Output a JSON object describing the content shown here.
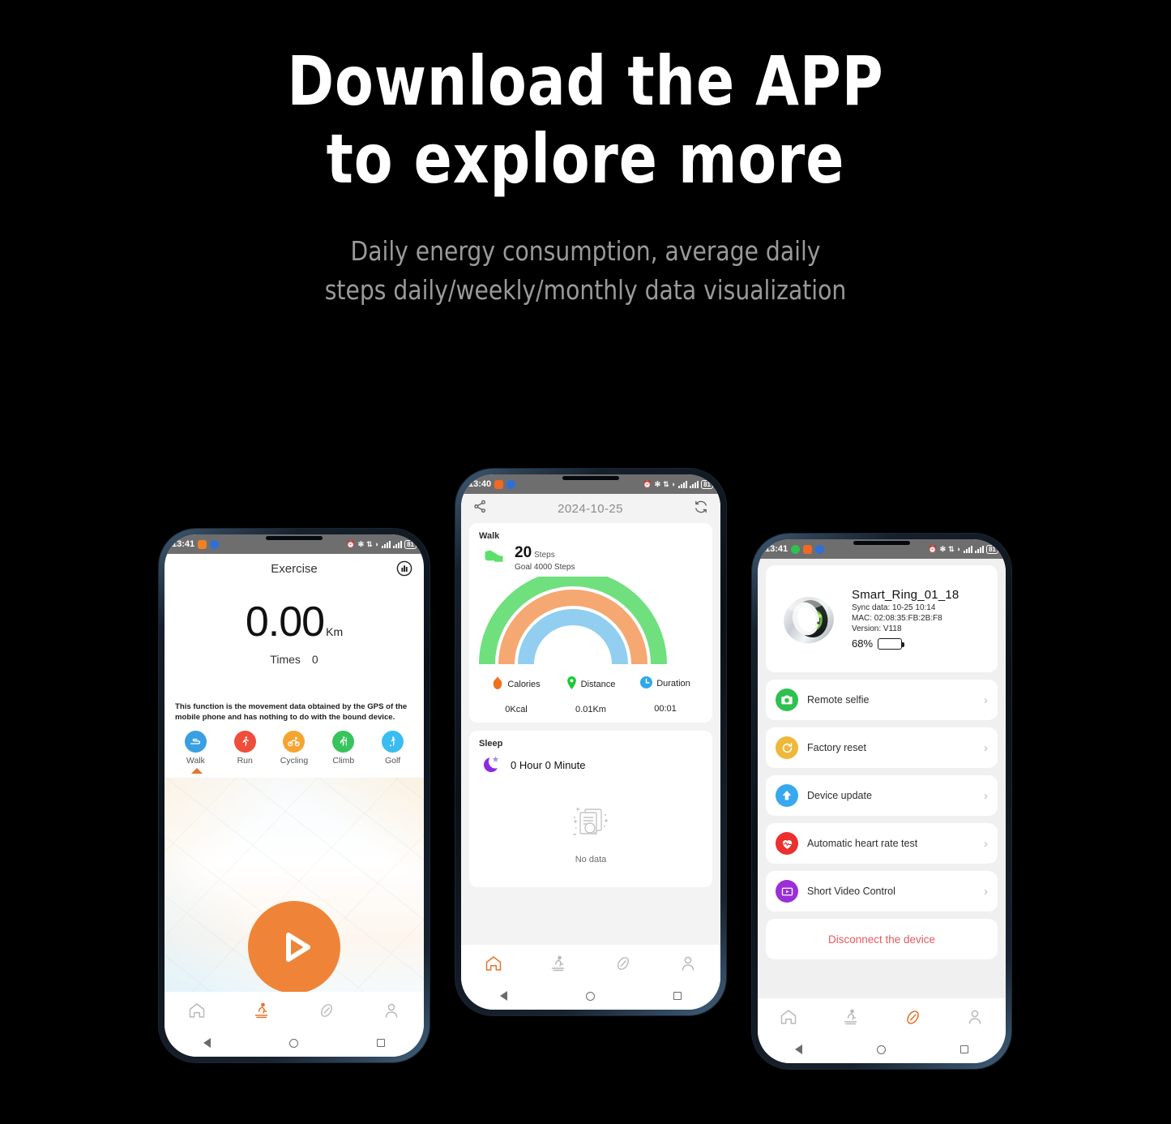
{
  "hero": {
    "title_line1": "Download the APP",
    "title_line2": "to explore more",
    "subtitle_line1": "Daily energy consumption, average daily",
    "subtitle_line2": "steps daily/weekly/monthly data visualization"
  },
  "colors": {
    "accent_orange": "#ef8439",
    "gauge_green": "#6fe07d",
    "gauge_orange": "#f5a872",
    "gauge_blue": "#92cef0",
    "disconnect_red": "#e05a62",
    "battery_green": "#22c82a",
    "status_bar_bg": "#6e6e6e"
  },
  "phone_left": {
    "status": {
      "time": "13:41",
      "battery": "81"
    },
    "header": {
      "title": "Exercise",
      "chart_icon": "bar-chart-icon"
    },
    "distance": {
      "value": "0.00",
      "unit": "Km"
    },
    "times": {
      "label": "Times",
      "value": "0"
    },
    "note": "This function is the movement data obtained by the GPS of the mobile phone and has nothing to do with the bound device.",
    "sports": [
      {
        "label": "Walk",
        "icon": "walk-icon",
        "color": "#3a9fe0"
      },
      {
        "label": "Run",
        "icon": "run-icon",
        "color": "#ef4e3a"
      },
      {
        "label": "Cycling",
        "icon": "cycling-icon",
        "color": "#f5a430"
      },
      {
        "label": "Climb",
        "icon": "climb-icon",
        "color": "#38c45c"
      },
      {
        "label": "Golf",
        "icon": "golf-icon",
        "color": "#39bdf0"
      }
    ],
    "selected_sport": "Walk",
    "play_button": "start-exercise-button",
    "tabs": [
      {
        "name": "home",
        "icon": "home-icon",
        "active": false
      },
      {
        "name": "sport",
        "icon": "treadmill-icon",
        "active": true
      },
      {
        "name": "device",
        "icon": "ring-icon",
        "active": false
      },
      {
        "name": "profile",
        "icon": "person-icon",
        "active": false
      }
    ]
  },
  "phone_mid": {
    "status": {
      "time": "13:40",
      "battery": "81"
    },
    "header": {
      "share_icon": "share-icon",
      "date": "2024-10-25",
      "refresh_icon": "refresh-icon"
    },
    "walk_card": {
      "label": "Walk",
      "steps_value": "20",
      "steps_unit": "Steps",
      "goal": "Goal 4000 Steps",
      "metrics": [
        {
          "label": "Calories",
          "value": "0Kcal",
          "icon": "flame-icon",
          "color": "#f0701e"
        },
        {
          "label": "Distance",
          "value": "0.01Km",
          "icon": "location-icon",
          "color": "#19cb35"
        },
        {
          "label": "Duration",
          "value": "00:01",
          "icon": "clock-icon",
          "color": "#2fa8e8"
        }
      ]
    },
    "sleep_card": {
      "label": "Sleep",
      "duration": "0 Hour 0 Minute",
      "empty_text": "No data",
      "moon_icon": "moon-star-icon"
    },
    "tabs": [
      {
        "name": "home",
        "icon": "home-icon",
        "active": true
      },
      {
        "name": "sport",
        "icon": "treadmill-icon",
        "active": false
      },
      {
        "name": "device",
        "icon": "ring-icon",
        "active": false
      },
      {
        "name": "profile",
        "icon": "person-icon",
        "active": false
      }
    ]
  },
  "phone_right": {
    "status": {
      "time": "13:41",
      "battery": "81"
    },
    "device": {
      "name": "Smart_Ring_01_18",
      "sync": "Sync data: 10-25 10:14",
      "mac": "MAC: 02:08:35:FB:2B:F8",
      "version": "Version: V118",
      "battery_pct": "68%",
      "battery_level": 68,
      "image": "smart-ring-photo"
    },
    "menu": [
      {
        "label": "Remote selfie",
        "icon": "camera-icon",
        "color": "#2fc14f"
      },
      {
        "label": "Factory reset",
        "icon": "reset-icon",
        "color": "#efb83a"
      },
      {
        "label": "Device update",
        "icon": "up-arrow-icon",
        "color": "#38a8ef"
      },
      {
        "label": "Automatic heart rate test",
        "icon": "heart-rate-icon",
        "color": "#ec2f2f"
      },
      {
        "label": "Short Video Control",
        "icon": "video-icon",
        "color": "#9b2fd6"
      }
    ],
    "disconnect_label": "Disconnect the device",
    "chevron": "›",
    "tabs": [
      {
        "name": "home",
        "icon": "home-icon",
        "active": false
      },
      {
        "name": "sport",
        "icon": "treadmill-icon",
        "active": false
      },
      {
        "name": "device",
        "icon": "ring-icon",
        "active": true
      },
      {
        "name": "profile",
        "icon": "person-icon",
        "active": false
      }
    ]
  }
}
